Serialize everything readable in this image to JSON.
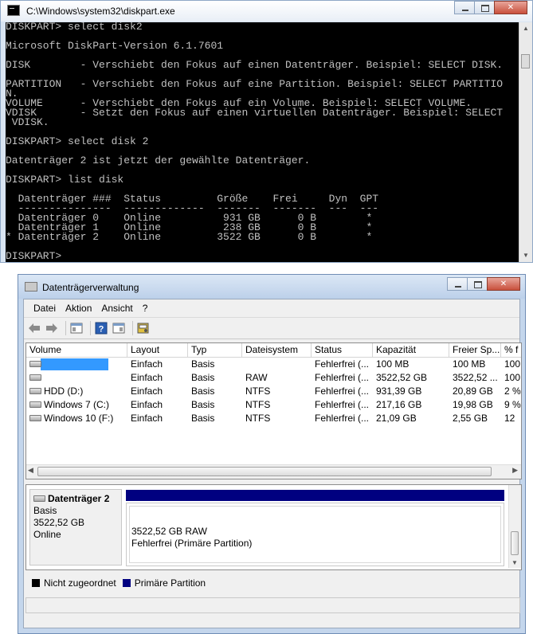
{
  "console": {
    "title": "C:\\Windows\\system32\\diskpart.exe",
    "lines": [
      "DISKPART> select disk2",
      "",
      "Microsoft DiskPart-Version 6.1.7601",
      "",
      "DISK        - Verschiebt den Fokus auf einen Datenträger. Beispiel: SELECT DISK.",
      "",
      "PARTITION   - Verschiebt den Fokus auf eine Partition. Beispiel: SELECT PARTITIO",
      "N.",
      "VOLUME      - Verschiebt den Fokus auf ein Volume. Beispiel: SELECT VOLUME.",
      "VDISK       - Setzt den Fokus auf einen virtuellen Datenträger. Beispiel: SELECT",
      " VDISK.",
      "",
      "DISKPART> select disk 2",
      "",
      "Datenträger 2 ist jetzt der gewählte Datenträger.",
      "",
      "DISKPART> list disk",
      "",
      "  Datenträger ###  Status         Größe    Frei     Dyn  GPT",
      "  ---------------  -------------  -------  -------  ---  ---",
      "  Datenträger 0    Online          931 GB      0 B        *",
      "  Datenträger 1    Online          238 GB      0 B        *",
      "* Datenträger 2    Online         3522 GB      0 B        *",
      "",
      "DISKPART>"
    ]
  },
  "dm": {
    "title": "Datenträgerverwaltung",
    "menu": [
      "Datei",
      "Aktion",
      "Ansicht",
      "?"
    ],
    "columns": [
      "Volume",
      "Layout",
      "Typ",
      "Dateisystem",
      "Status",
      "Kapazität",
      "Freier Sp...",
      "% f"
    ],
    "rows": [
      {
        "volume": "",
        "layout": "Einfach",
        "typ": "Basis",
        "fs": "",
        "status": "Fehlerfrei (...",
        "kap": "100 MB",
        "frei": "100 MB",
        "pct": "100"
      },
      {
        "volume": "",
        "layout": "Einfach",
        "typ": "Basis",
        "fs": "RAW",
        "status": "Fehlerfrei (...",
        "kap": "3522,52 GB",
        "frei": "3522,52 ...",
        "pct": "100"
      },
      {
        "volume": "HDD (D:)",
        "layout": "Einfach",
        "typ": "Basis",
        "fs": "NTFS",
        "status": "Fehlerfrei (...",
        "kap": "931,39 GB",
        "frei": "20,89 GB",
        "pct": "2 %"
      },
      {
        "volume": "Windows 7 (C:)",
        "layout": "Einfach",
        "typ": "Basis",
        "fs": "NTFS",
        "status": "Fehlerfrei (...",
        "kap": "217,16 GB",
        "frei": "19,98 GB",
        "pct": "9 %"
      },
      {
        "volume": "Windows 10 (F:)",
        "layout": "Einfach",
        "typ": "Basis",
        "fs": "NTFS",
        "status": "Fehlerfrei (...",
        "kap": "21,09 GB",
        "frei": "2,55 GB",
        "pct": "12"
      }
    ],
    "disk": {
      "name": "Datenträger 2",
      "type": "Basis",
      "size": "3522,52 GB",
      "state": "Online",
      "partition_line1": "3522,52 GB RAW",
      "partition_line2": "Fehlerfrei (Primäre Partition)"
    },
    "legend": [
      {
        "label": "Nicht zugeordnet",
        "color": "#000000"
      },
      {
        "label": "Primäre Partition",
        "color": "#000080"
      }
    ]
  }
}
